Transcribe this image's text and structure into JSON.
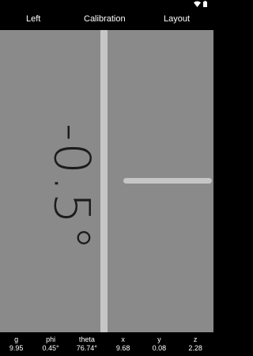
{
  "menu": {
    "left": "Left",
    "calibration": "Calibration",
    "layout": "Layout"
  },
  "status_bar": {
    "icons": [
      "wifi-icon",
      "battery-icon"
    ]
  },
  "gauge": {
    "angle_text": "-0.5°",
    "angle_value": -0.5
  },
  "stats": {
    "g": {
      "label": "g",
      "value": "9.95"
    },
    "phi": {
      "label": "phi",
      "value": "0.45°"
    },
    "theta": {
      "label": "theta",
      "value": "76.74°"
    },
    "x": {
      "label": "x",
      "value": "9.68"
    },
    "y": {
      "label": "y",
      "value": "0.08"
    },
    "z": {
      "label": "z",
      "value": "2.28"
    }
  },
  "colors": {
    "background": "#8a8a8a",
    "bars": "#000000",
    "lines": "#c6c6c6",
    "readout": "#1c1c1c"
  }
}
